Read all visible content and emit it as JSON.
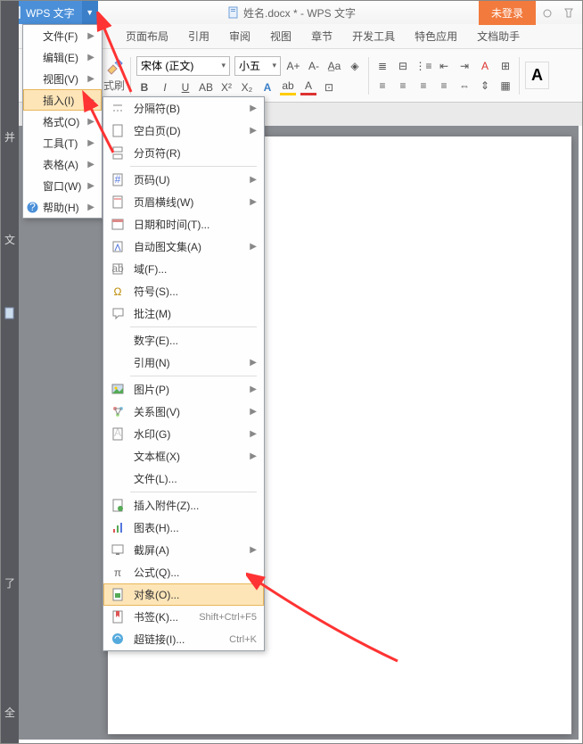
{
  "titlebar": {
    "app_name": "WPS 文字",
    "doc_title": "姓名.docx * - WPS 文字",
    "login": "未登录"
  },
  "ribbon": {
    "tabs": [
      "页面布局",
      "引用",
      "审阅",
      "视图",
      "章节",
      "开发工具",
      "特色应用",
      "文档助手"
    ],
    "format_brush": "式刷",
    "font_name": "宋体 (正文)",
    "font_size": "小五"
  },
  "main_menu": {
    "items": [
      {
        "label": "文件(F)",
        "sub": true
      },
      {
        "label": "编辑(E)",
        "sub": true
      },
      {
        "label": "视图(V)",
        "sub": true
      },
      {
        "label": "插入(I)",
        "sub": true,
        "hl": true
      },
      {
        "label": "格式(O)",
        "sub": true
      },
      {
        "label": "工具(T)",
        "sub": true
      },
      {
        "label": "表格(A)",
        "sub": true
      },
      {
        "label": "窗口(W)",
        "sub": true
      },
      {
        "label": "帮助(H)",
        "sub": true,
        "help": true
      }
    ]
  },
  "sub_menu": {
    "items": [
      {
        "label": "分隔符(B)",
        "arr": true,
        "ico": "sep"
      },
      {
        "label": "空白页(D)",
        "arr": true,
        "ico": "blank"
      },
      {
        "label": "分页符(R)",
        "ico": "pagebreak"
      },
      {
        "type": "sep"
      },
      {
        "label": "页码(U)",
        "arr": true,
        "ico": "pagenum"
      },
      {
        "label": "页眉横线(W)",
        "arr": true,
        "ico": "headerline"
      },
      {
        "label": "日期和时间(T)...",
        "ico": "datetime"
      },
      {
        "label": "自动图文集(A)",
        "arr": true,
        "ico": "autotext"
      },
      {
        "label": "域(F)...",
        "ico": "field"
      },
      {
        "label": "符号(S)...",
        "ico": "symbol"
      },
      {
        "label": "批注(M)",
        "ico": "comment"
      },
      {
        "type": "sep"
      },
      {
        "label": "数字(E)...",
        "ico": ""
      },
      {
        "label": "引用(N)",
        "arr": true,
        "ico": ""
      },
      {
        "type": "sep"
      },
      {
        "label": "图片(P)",
        "arr": true,
        "ico": "pic"
      },
      {
        "label": "关系图(V)",
        "arr": true,
        "ico": "rel"
      },
      {
        "label": "水印(G)",
        "arr": true,
        "ico": "water"
      },
      {
        "label": "文本框(X)",
        "arr": true,
        "ico": ""
      },
      {
        "label": "文件(L)...",
        "ico": ""
      },
      {
        "type": "sep"
      },
      {
        "label": "插入附件(Z)...",
        "ico": "attach"
      },
      {
        "label": "图表(H)...",
        "ico": "chart"
      },
      {
        "label": "截屏(A)",
        "arr": true,
        "ico": "screen"
      },
      {
        "label": "公式(Q)...",
        "ico": "formula"
      },
      {
        "label": "对象(O)...",
        "ico": "object",
        "hl": true
      },
      {
        "label": "书签(K)...",
        "sc": "Shift+Ctrl+F5",
        "ico": "bookmark"
      },
      {
        "label": "超链接(I)...",
        "sc": "Ctrl+K",
        "ico": "link"
      }
    ]
  },
  "strip": {
    "t1": "并",
    "t2": "文",
    "t3": "了",
    "t4": "全"
  }
}
